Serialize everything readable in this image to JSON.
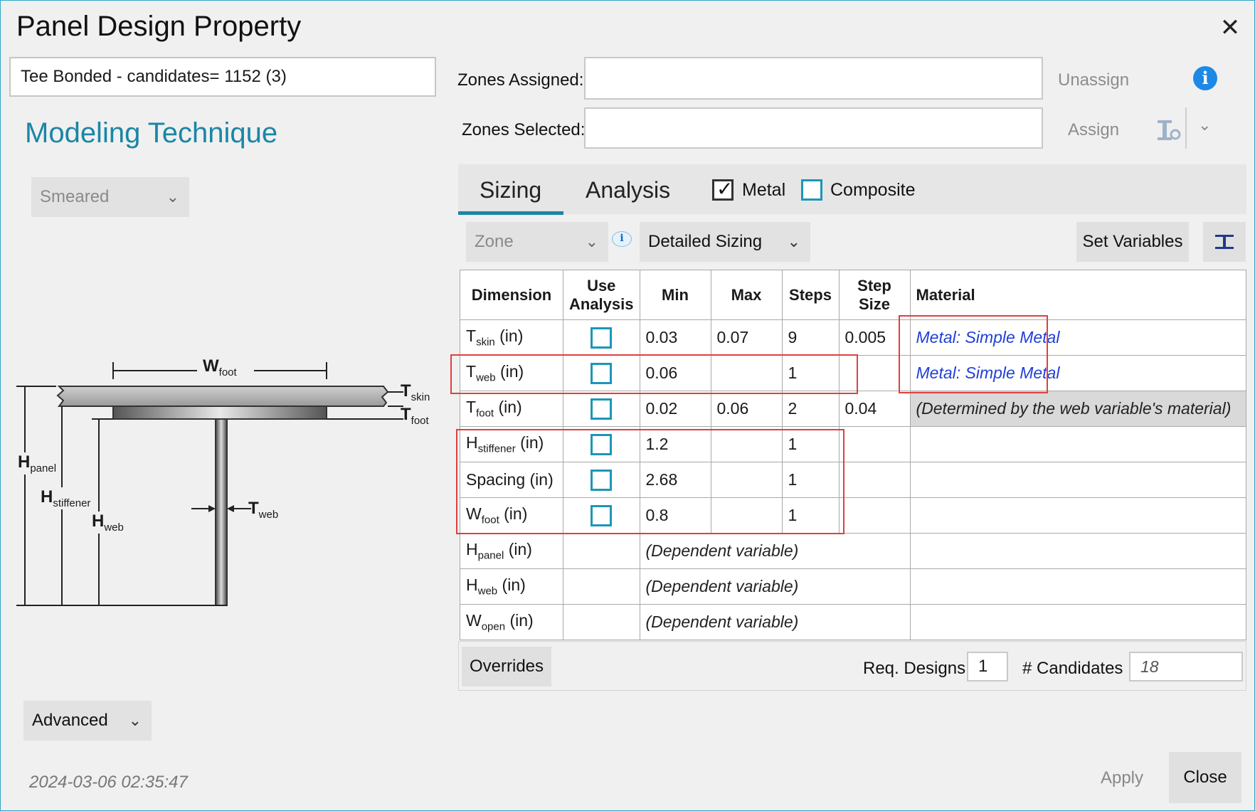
{
  "window": {
    "title": "Panel Design Property"
  },
  "property_name": "Tee Bonded - candidates= 1152 (3)",
  "section_title": "Modeling Technique",
  "technique_dropdown": "Smeared",
  "zones": {
    "assigned_label": "Zones Assigned:",
    "selected_label": "Zones Selected:",
    "assigned_value": "",
    "selected_value": "",
    "unassign_label": "Unassign",
    "assign_label": "Assign"
  },
  "tabs": [
    {
      "label": "Sizing",
      "active": true
    },
    {
      "label": "Analysis",
      "active": false
    }
  ],
  "material_filters": [
    {
      "label": "Metal",
      "checked": true
    },
    {
      "label": "Composite",
      "checked": false
    }
  ],
  "toolbar": {
    "zone_dropdown": "Zone",
    "sizing_dropdown": "Detailed Sizing",
    "set_variables_label": "Set Variables"
  },
  "table": {
    "headers": {
      "dimension": "Dimension",
      "use_line1": "Use",
      "use_line2": "Analysis",
      "min": "Min",
      "max": "Max",
      "steps": "Steps",
      "step_line1": "Step",
      "step_line2": "Size",
      "material": "Material"
    },
    "rows": [
      {
        "sym": "T",
        "sub": "skin",
        "unit": "(in)",
        "min": "0.03",
        "max": "0.07",
        "steps": "9",
        "step_size": "0.005",
        "material": "Metal: Simple Metal"
      },
      {
        "sym": "T",
        "sub": "web",
        "unit": "(in)",
        "min": "0.06",
        "max": "",
        "steps": "1",
        "step_size": "",
        "material": "Metal: Simple Metal"
      },
      {
        "sym": "T",
        "sub": "foot",
        "unit": "(in)",
        "min": "0.02",
        "max": "0.06",
        "steps": "2",
        "step_size": "0.04",
        "material": "(Determined by the web variable's material)"
      },
      {
        "sym": "H",
        "sub": "stiffener",
        "unit": "(in)",
        "min": "1.2",
        "max": "",
        "steps": "1",
        "step_size": "",
        "material": ""
      },
      {
        "sym": "Spacing",
        "sub": "",
        "unit": "(in)",
        "min": "2.68",
        "max": "",
        "steps": "1",
        "step_size": "",
        "material": ""
      },
      {
        "sym": "W",
        "sub": "foot",
        "unit": "(in)",
        "min": "0.8",
        "max": "",
        "steps": "1",
        "step_size": "",
        "material": ""
      },
      {
        "sym": "H",
        "sub": "panel",
        "unit": "(in)",
        "dependent": "(Dependent variable)"
      },
      {
        "sym": "H",
        "sub": "web",
        "unit": "(in)",
        "dependent": "(Dependent variable)"
      },
      {
        "sym": "W",
        "sub": "open",
        "unit": "(in)",
        "dependent": "(Dependent variable)"
      }
    ]
  },
  "bottom": {
    "overrides_label": "Overrides",
    "req_designs_label": "Req. Designs",
    "req_designs_value": "1",
    "candidates_label": "# Candidates",
    "candidates_value": "18"
  },
  "diagram": {
    "w_foot": {
      "sym": "W",
      "sub": "foot"
    },
    "t_skin": {
      "sym": "T",
      "sub": "skin"
    },
    "t_foot": {
      "sym": "T",
      "sub": "foot"
    },
    "h_panel": {
      "sym": "H",
      "sub": "panel"
    },
    "h_stiffener": {
      "sym": "H",
      "sub": "stiffener"
    },
    "h_web": {
      "sym": "H",
      "sub": "web"
    },
    "t_web": {
      "sym": "T",
      "sub": "web"
    }
  },
  "advanced_label": "Advanced",
  "timestamp": "2024-03-06 02:35:47",
  "buttons": {
    "apply": "Apply",
    "close": "Close"
  }
}
